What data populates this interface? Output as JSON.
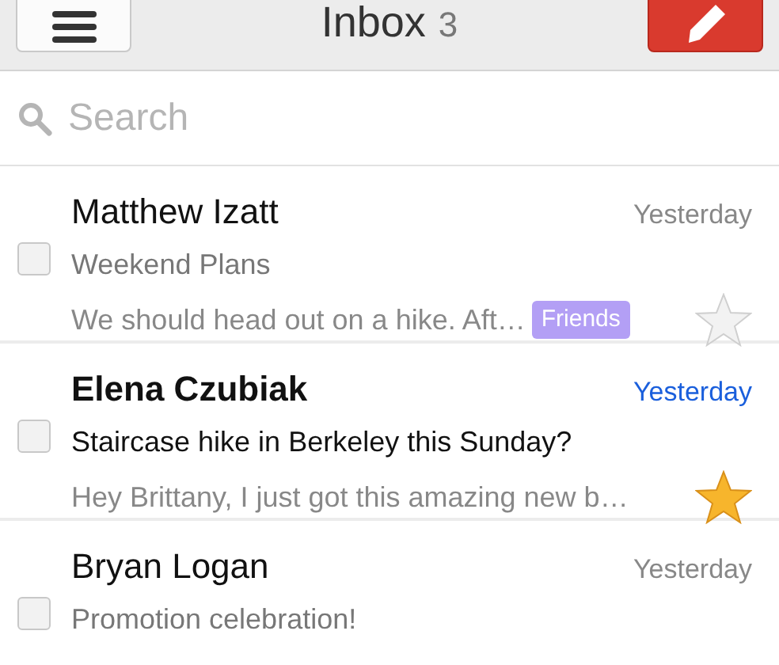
{
  "header": {
    "title": "Inbox",
    "count": "3"
  },
  "search": {
    "placeholder": "Search"
  },
  "messages": [
    {
      "sender": "Matthew Izatt",
      "date": "Yesterday",
      "subject": "Weekend Plans",
      "preview": "We should head out on a hike. Aft…",
      "label": {
        "text": "Friends",
        "color": "#b39ff5"
      },
      "unread": false,
      "checked": false,
      "starred": false
    },
    {
      "sender": "Elena Czubiak",
      "date": "Yesterday",
      "subject": "Staircase hike in Berkeley this Sunday?",
      "preview": "Hey Brittany, I just got this amazing new b…",
      "unread": true,
      "checked": false,
      "starred": true
    },
    {
      "sender": "Bryan Logan",
      "date": "Yesterday",
      "subject": "Promotion celebration!",
      "unread": false,
      "checked": false
    }
  ]
}
